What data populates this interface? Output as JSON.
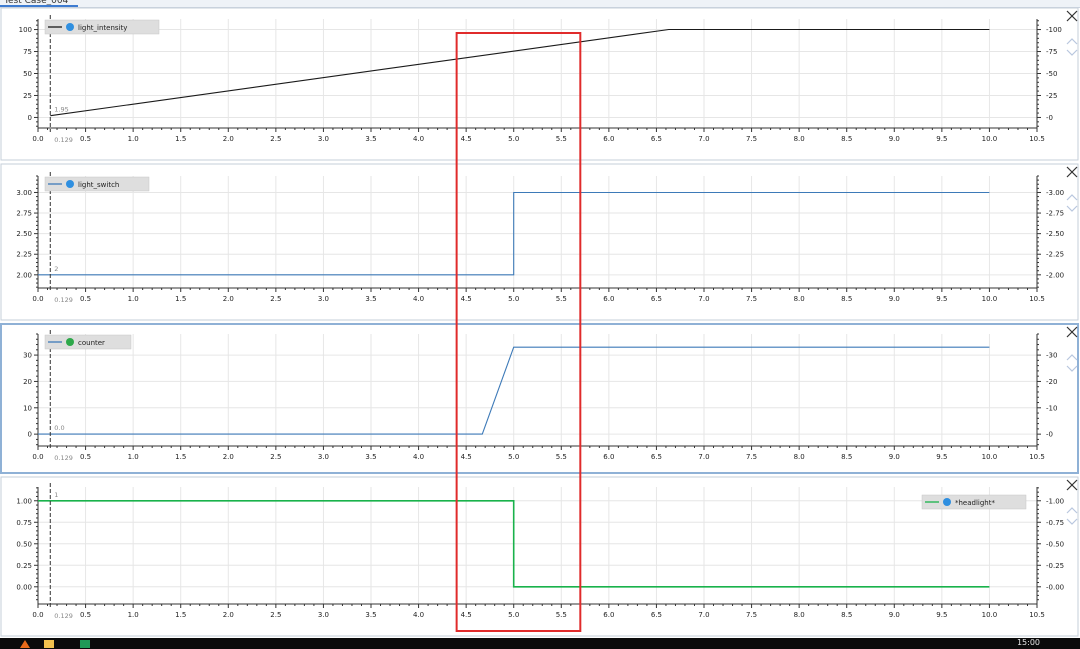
{
  "window": {
    "tab_label": "Test Case_004",
    "clock": "15:00"
  },
  "colors": {
    "line_black": "#1a1a1a",
    "line_blue": "#3d7ab8",
    "line_green": "#19b24b",
    "highlight": "#e02b2b",
    "icon_blue": "#2f8fe0",
    "icon_green": "#2da84a"
  },
  "highlight_box": {
    "x_range": [
      4.4,
      5.7
    ],
    "color": "#e02b2b"
  },
  "chart_data": [
    {
      "type": "line",
      "legend": "light_intensity",
      "legend_icon": "c-icon",
      "legend_position": "top-left",
      "xlim": [
        0,
        10.5
      ],
      "ylim": [
        -12,
        112
      ],
      "xticks": [
        "0.0",
        "0.5",
        "1.0",
        "1.5",
        "2.0",
        "2.5",
        "3.0",
        "3.5",
        "4.0",
        "4.5",
        "5.0",
        "5.5",
        "6.0",
        "6.5",
        "7.0",
        "7.5",
        "8.0",
        "8.5",
        "9.0",
        "9.5",
        "10.0",
        "10.5"
      ],
      "yticks": [
        0,
        25,
        50,
        75,
        100
      ],
      "ytick_labels": [
        "0",
        "25",
        "50",
        "75",
        "100"
      ],
      "cursor": {
        "x": 0.129,
        "x_label": "0.129",
        "value_label": "1.95"
      },
      "series": [
        {
          "color": "line_black",
          "x": [
            0.129,
            6.63,
            10.0
          ],
          "y": [
            1.95,
            100,
            100
          ]
        }
      ]
    },
    {
      "type": "line",
      "legend": "light_switch",
      "legend_icon": "c-icon",
      "legend_position": "top-left",
      "xlim": [
        0,
        10.5
      ],
      "ylim": [
        1.84,
        3.2
      ],
      "xticks": [
        "0.0",
        "0.5",
        "1.0",
        "1.5",
        "2.0",
        "2.5",
        "3.0",
        "3.5",
        "4.0",
        "4.5",
        "5.0",
        "5.5",
        "6.0",
        "6.5",
        "7.0",
        "7.5",
        "8.0",
        "8.5",
        "9.0",
        "9.5",
        "10.0",
        "10.5"
      ],
      "yticks": [
        2.0,
        2.25,
        2.5,
        2.75,
        3.0
      ],
      "ytick_labels": [
        "2.00",
        "2.25",
        "2.50",
        "2.75",
        "3.00"
      ],
      "cursor": {
        "x": 0.129,
        "x_label": "0.129",
        "value_label": "2"
      },
      "series": [
        {
          "color": "line_blue",
          "x": [
            0.0,
            5.0,
            5.0,
            10.0
          ],
          "y": [
            2.0,
            2.0,
            3.0,
            3.0
          ]
        }
      ]
    },
    {
      "type": "line",
      "legend": "counter",
      "legend_icon": "h-icon",
      "legend_position": "top-left",
      "selected": true,
      "xlim": [
        0,
        10.5
      ],
      "ylim": [
        -4.5,
        38
      ],
      "xticks": [
        "0.0",
        "0.5",
        "1.0",
        "1.5",
        "2.0",
        "2.5",
        "3.0",
        "3.5",
        "4.0",
        "4.5",
        "5.0",
        "5.5",
        "6.0",
        "6.5",
        "7.0",
        "7.5",
        "8.0",
        "8.5",
        "9.0",
        "9.5",
        "10.0",
        "10.5"
      ],
      "yticks": [
        0,
        10,
        20,
        30
      ],
      "ytick_labels": [
        "0",
        "10",
        "20",
        "30"
      ],
      "cursor": {
        "x": 0.129,
        "x_label": "0.129",
        "value_label": "0.0"
      },
      "series": [
        {
          "color": "line_blue",
          "x": [
            0.0,
            4.67,
            5.0,
            10.0
          ],
          "y": [
            0,
            0,
            33,
            33
          ]
        }
      ]
    },
    {
      "type": "line",
      "legend": "*headlight*",
      "legend_icon": "c-icon",
      "legend_position": "top-right",
      "xlim": [
        0,
        10.5
      ],
      "ylim": [
        -0.2,
        1.16
      ],
      "xticks": [
        "0.0",
        "0.5",
        "1.0",
        "1.5",
        "2.0",
        "2.5",
        "3.0",
        "3.5",
        "4.0",
        "4.5",
        "5.0",
        "5.5",
        "6.0",
        "6.5",
        "7.0",
        "7.5",
        "8.0",
        "8.5",
        "9.0",
        "9.5",
        "10.0",
        "10.5"
      ],
      "yticks": [
        0.0,
        0.25,
        0.5,
        0.75,
        1.0
      ],
      "ytick_labels": [
        "0.00",
        "0.25",
        "0.50",
        "0.75",
        "1.00"
      ],
      "cursor": {
        "x": 0.129,
        "x_label": "0.129",
        "value_label": "1"
      },
      "series": [
        {
          "color": "line_green",
          "x": [
            0.0,
            5.0,
            5.0,
            10.0
          ],
          "y": [
            1.0,
            1.0,
            0.0,
            0.0
          ]
        }
      ]
    }
  ]
}
